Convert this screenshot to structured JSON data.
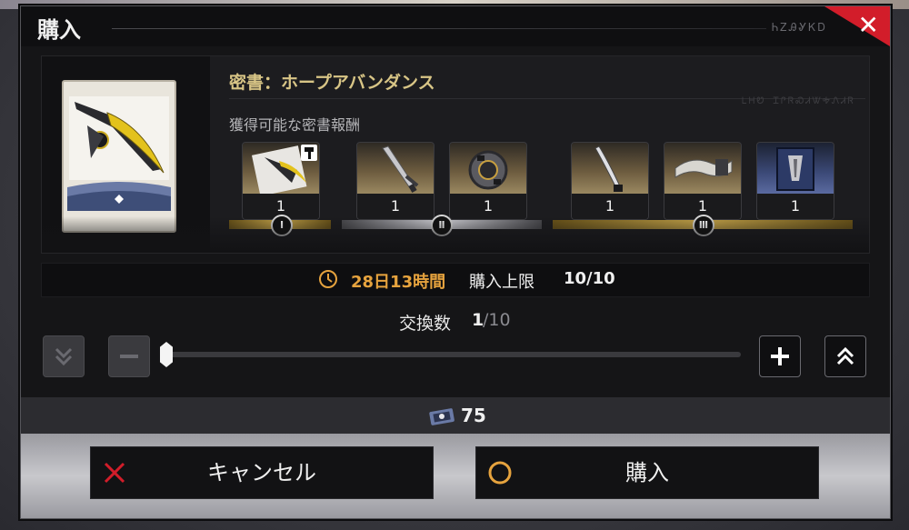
{
  "dialog": {
    "title": "購入",
    "title_decoration": "ᏂᏃᎯᎽᏦᎠ",
    "close_label": "✕"
  },
  "item": {
    "name": "密書：ホープアバンダンス",
    "rewards_label": "獲得可能な密書報酬",
    "decoration_text": "ᏞᎻᏬ ᏆᎵᏒᏍᏗᏔᎭᏁᏗᏒ"
  },
  "rewards": [
    {
      "tier": "Ⅰ",
      "quantity": "1",
      "icon": "gold-scythe-book-icon"
    },
    {
      "tier": "Ⅱ",
      "quantity": "1",
      "icon": "sword-icon"
    },
    {
      "tier": "Ⅱ",
      "quantity": "1",
      "icon": "orb-core-icon"
    },
    {
      "tier": "Ⅲ",
      "quantity": "1",
      "icon": "blade-icon"
    },
    {
      "tier": "Ⅲ",
      "quantity": "1",
      "icon": "scroll-icon"
    },
    {
      "tier": "Ⅲ",
      "quantity": "1",
      "icon": "blue-book-icon"
    }
  ],
  "tiers": [
    "Ⅰ",
    "Ⅱ",
    "Ⅲ"
  ],
  "info": {
    "time_remaining": "28日13時間",
    "purchase_limit_label": "購入上限",
    "purchase_limit_value": "10/10"
  },
  "exchange": {
    "label": "交換数",
    "current": "1",
    "max": "/10",
    "slider_fraction": 0
  },
  "cost": {
    "value": "75",
    "icon": "ticket-currency-icon"
  },
  "buttons": {
    "cancel": "キャンセル",
    "buy": "購入"
  },
  "colors": {
    "accent_gold": "#e6a33e",
    "close_red": "#d21d2a",
    "item_name": "#d8c586"
  }
}
